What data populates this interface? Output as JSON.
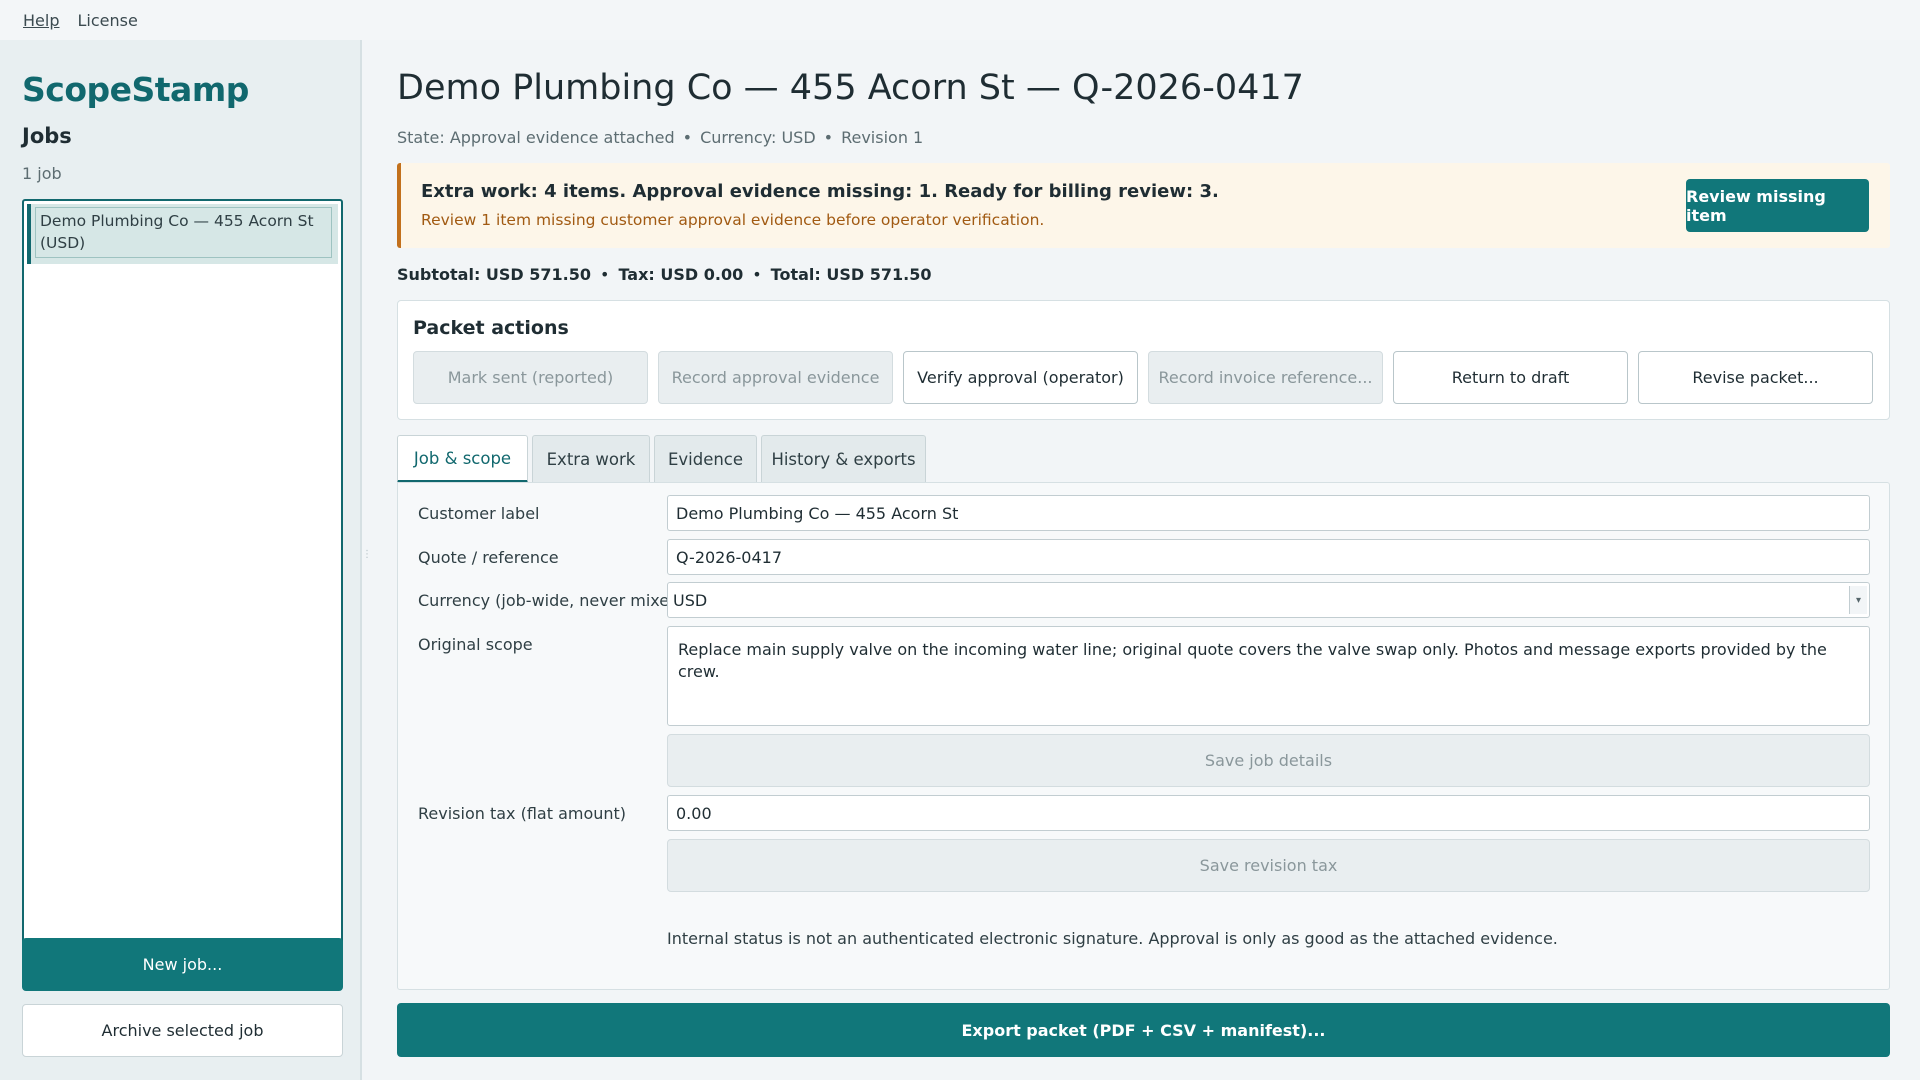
{
  "menu": {
    "help": "Help",
    "license": "License"
  },
  "sidebar": {
    "brand": "ScopeStamp",
    "jobs_heading": "Jobs",
    "jobs_count": "1 job",
    "jobs": [
      {
        "label": "Demo Plumbing Co — 455 Acorn St (USD)"
      }
    ],
    "new_job": "New job...",
    "archive_job": "Archive selected job"
  },
  "header": {
    "title": "Demo Plumbing Co — 455 Acorn St — Q-2026-0417",
    "state": "State: Approval evidence attached",
    "currency": "Currency: USD",
    "revision": "Revision 1",
    "separator": "•"
  },
  "banner": {
    "title": "Extra work: 4 items. Approval evidence missing: 1. Ready for billing review: 3.",
    "subtitle": "Review 1 item missing customer approval evidence before operator verification.",
    "action": "Review missing item",
    "accent": "#c2701c"
  },
  "totals": {
    "subtotal": "Subtotal: USD 571.50",
    "tax": "Tax: USD 0.00",
    "total": "Total: USD 571.50"
  },
  "packet_actions": {
    "heading": "Packet actions",
    "buttons": [
      {
        "label": "Mark sent (reported)",
        "enabled": false
      },
      {
        "label": "Record approval evidence",
        "enabled": false
      },
      {
        "label": "Verify approval (operator)",
        "enabled": true
      },
      {
        "label": "Record invoice reference...",
        "enabled": false
      },
      {
        "label": "Return to draft",
        "enabled": true
      },
      {
        "label": "Revise packet...",
        "enabled": true
      }
    ]
  },
  "tabs": [
    {
      "label": "Job & scope",
      "active": true
    },
    {
      "label": "Extra work",
      "active": false
    },
    {
      "label": "Evidence",
      "active": false
    },
    {
      "label": "History & exports",
      "active": false
    }
  ],
  "form": {
    "customer_label": {
      "label": "Customer label",
      "value": "Demo Plumbing Co — 455 Acorn St"
    },
    "quote_ref": {
      "label": "Quote / reference",
      "value": "Q-2026-0417"
    },
    "currency": {
      "label": "Currency (job-wide, never mixed)",
      "value": "USD"
    },
    "original_scope": {
      "label": "Original scope",
      "value": "Replace main supply valve on the incoming water line; original quote covers the valve swap only. Photos and message exports provided by the crew."
    },
    "save_job": "Save job details",
    "revision_tax": {
      "label": "Revision tax (flat amount)",
      "value": "0.00"
    },
    "save_tax": "Save revision tax",
    "note": "Internal status is not an authenticated electronic signature. Approval is only as good as the attached evidence."
  },
  "export": "Export packet (PDF + CSV + manifest)...",
  "colors": {
    "brand": "#11686e",
    "primary": "#11777a",
    "warning": "#c2701c"
  }
}
